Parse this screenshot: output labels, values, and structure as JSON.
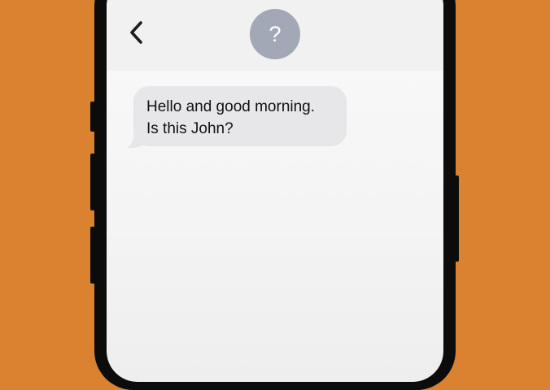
{
  "contact": {
    "avatar_glyph": "?"
  },
  "messages": [
    {
      "direction": "incoming",
      "lines": [
        "Hello and good morning.",
        "Is this John?"
      ]
    }
  ],
  "colors": {
    "background": "#DB8230",
    "header": "#f1f1f1",
    "avatar": "#a2a8b6",
    "incoming_bubble": "#e7e7ea"
  }
}
